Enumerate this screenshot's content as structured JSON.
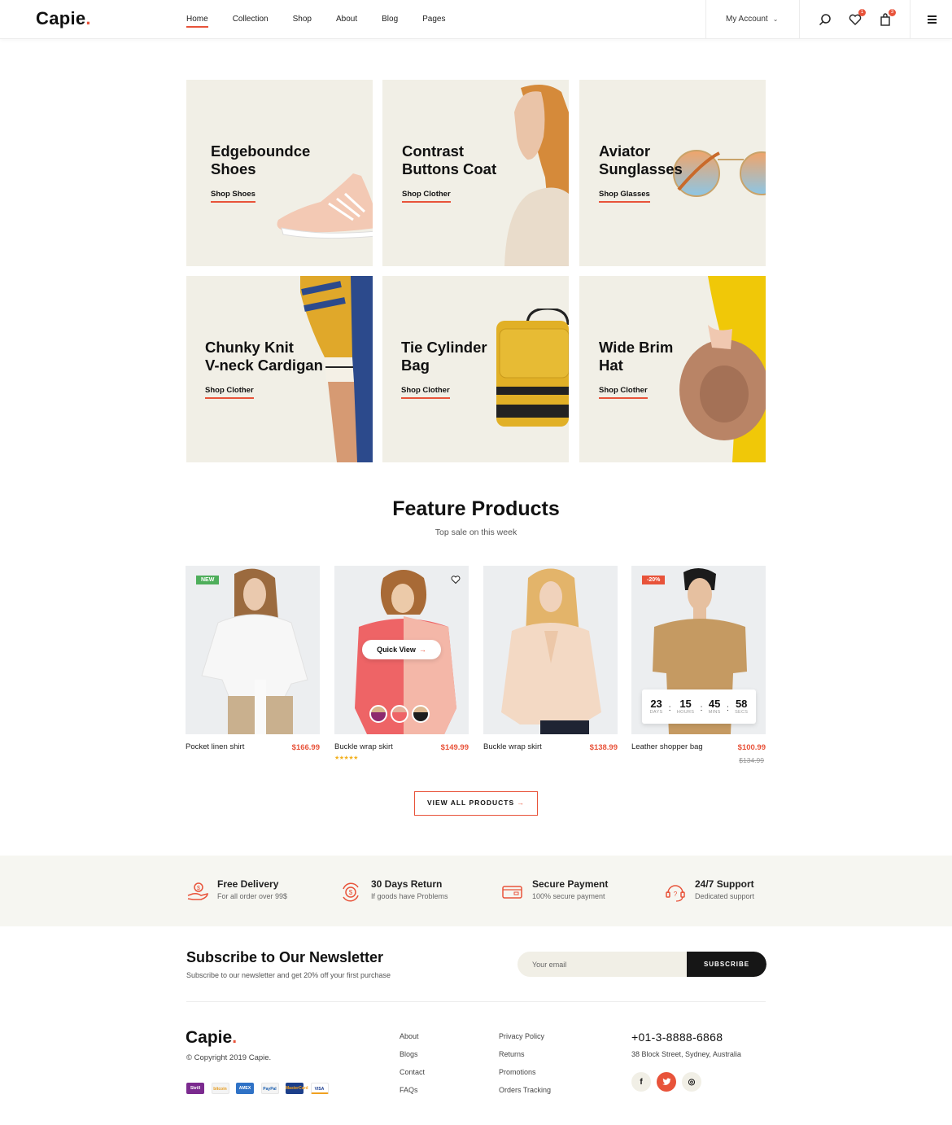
{
  "header": {
    "logo": "Capie",
    "logo_dot": ".",
    "nav": [
      {
        "label": "Home",
        "active": true
      },
      {
        "label": "Collection"
      },
      {
        "label": "Shop"
      },
      {
        "label": "About"
      },
      {
        "label": "Blog"
      },
      {
        "label": "Pages"
      }
    ],
    "account_label": "My Account",
    "wishlist_count": "1",
    "cart_count": "3",
    "icons": [
      "search-icon",
      "heart-icon",
      "bag-icon",
      "menu-icon"
    ]
  },
  "banners": [
    {
      "title_line1": "Edgeboundce",
      "title_line2": "Shoes",
      "link": "Shop Shoes"
    },
    {
      "title_line1": "Contrast",
      "title_line2": "Buttons Coat",
      "link": "Shop Clother"
    },
    {
      "title_line1": "Aviator",
      "title_line2": "Sunglasses",
      "link": "Shop Glasses"
    },
    {
      "title_line1": "Chunky Knit",
      "title_line2": "V-neck Cardigan",
      "link": "Shop Clother"
    },
    {
      "title_line1": "Tie Cylinder",
      "title_line2": "Bag",
      "link": "Shop Clother"
    },
    {
      "title_line1": "Wide Brim",
      "title_line2": "Hat",
      "link": "Shop Clother"
    }
  ],
  "features": {
    "title": "Feature Products",
    "subtitle": "Top sale on this week",
    "products": [
      {
        "name": "Pocket linen shirt",
        "price": "$166.99",
        "tag": "NEW"
      },
      {
        "name": "Buckle wrap skirt",
        "price": "$149.99",
        "quick_view": "Quick View",
        "rating": 4.5,
        "stars": "★★★★★"
      },
      {
        "name": "Buckle wrap skirt",
        "price": "$138.99"
      },
      {
        "name": "Leather shopper bag",
        "price": "$100.99",
        "old_price": "$134.99",
        "tag": "-20%",
        "countdown": [
          {
            "value": "23",
            "label": "DAYS"
          },
          {
            "value": "15",
            "label": "HOURS"
          },
          {
            "value": "45",
            "label": "MINS"
          },
          {
            "value": "58",
            "label": "SECS"
          }
        ]
      }
    ],
    "view_all": "VIEW ALL PRODUCTS",
    "arrow": "→"
  },
  "services": [
    {
      "title": "Free Delivery",
      "sub": "For all order over 99$",
      "icon": "hand-coin-icon"
    },
    {
      "title": "30 Days Return",
      "sub": "If goods have Problems",
      "icon": "return-coin-icon"
    },
    {
      "title": "Secure Payment",
      "sub": "100% secure payment",
      "icon": "credit-card-icon"
    },
    {
      "title": "24/7 Support",
      "sub": "Dedicated support",
      "icon": "headset-icon"
    }
  ],
  "newsletter": {
    "title": "Subscribe to Our Newsletter",
    "sub": "Subscribe to our newsletter and get 20% off your first purchase",
    "placeholder": "Your email",
    "button": "SUBSCRIBE"
  },
  "footer": {
    "logo": "Capie",
    "logo_dot": ".",
    "copyright": "© Copyright 2019 Capie.",
    "payments": [
      "Skrill",
      "bitcoin",
      "AMEX",
      "PayPal",
      "MasterCard",
      "VISA"
    ],
    "col1": [
      "About",
      "Blogs",
      "Contact",
      "FAQs"
    ],
    "col2": [
      "Privacy Policy",
      "Returns",
      "Promotions",
      "Orders Tracking"
    ],
    "phone": "+01-3-8888-6868",
    "address": "38 Block Street, Sydney, Australia",
    "socials": [
      "f",
      "t",
      "◎"
    ]
  },
  "colors": {
    "accent": "#e8533a",
    "banner_bg": "#f1efe6",
    "new_tag": "#4eae5b",
    "dark": "#161616"
  }
}
